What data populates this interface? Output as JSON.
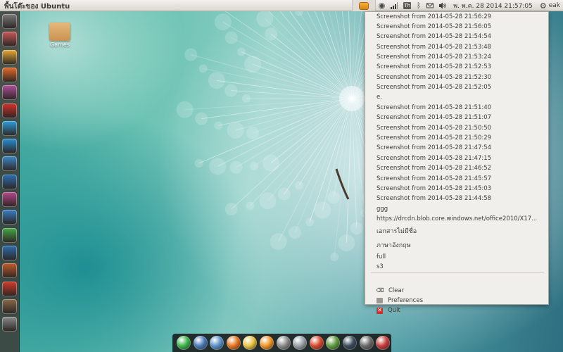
{
  "top_panel": {
    "window_title": "พื้นโต๊ะของ Ubuntu",
    "clock": "พ. พ.ค. 28 2014 21:57:05",
    "user": "eak",
    "keyboard_layout": "Th"
  },
  "desktop": {
    "icons": [
      {
        "label": "Games"
      }
    ]
  },
  "clipboard_menu": {
    "history": [
      "Screenshot from 2014-05-28 21:56:29",
      "Screenshot from 2014-05-28 21:56:05",
      "Screenshot from 2014-05-28 21:54:54",
      "Screenshot from 2014-05-28 21:53:48",
      "Screenshot from 2014-05-28 21:53:24",
      "Screenshot from 2014-05-28 21:52:53",
      "Screenshot from 2014-05-28 21:52:30",
      "Screenshot from 2014-05-28 21:52:05",
      "e.",
      "Screenshot from 2014-05-28 21:51:40",
      "Screenshot from 2014-05-28 21:51:07",
      "Screenshot from 2014-05-28 21:50:50",
      "Screenshot from 2014-05-28 21:50:29",
      "Screenshot from 2014-05-28 21:47:54",
      "Screenshot from 2014-05-28 21:47:15",
      "Screenshot from 2014-05-28 21:46:52",
      "Screenshot from 2014-05-28 21:45:57",
      "Screenshot from 2014-05-28 21:45:03",
      "Screenshot from 2014-05-28 21:44:58",
      "ggg",
      "https://drcdn.blob.core.windows.net/office2010/X17...",
      "เอกสารไม่มีชื่อ",
      "ภาษาอังกฤษ",
      " full",
      "s3"
    ],
    "actions": {
      "clear": "Clear",
      "preferences": "Preferences",
      "quit": "Quit"
    }
  },
  "launcher": {
    "items": [
      {
        "icon": "dash-home-icon",
        "color": "#7b7b7b"
      },
      {
        "icon": "files-icon",
        "color": "#c9595a"
      },
      {
        "icon": "chrome-icon",
        "color": "#e7a937"
      },
      {
        "icon": "firefox-icon",
        "color": "#e66b2a"
      },
      {
        "icon": "software-center-icon",
        "color": "#b0509a"
      },
      {
        "icon": "filezilla-icon",
        "color": "#d4322a"
      },
      {
        "icon": "skype-icon",
        "color": "#2d9fdb"
      },
      {
        "icon": "telegram-icon",
        "color": "#2a8fd6"
      },
      {
        "icon": "screenshot-icon",
        "color": "#3d88c8"
      },
      {
        "icon": "deluge-icon",
        "color": "#2f6fb2"
      },
      {
        "icon": "headphones-icon",
        "color": "#b7478d"
      },
      {
        "icon": "dropbox-icon",
        "color": "#3a7ec5"
      },
      {
        "icon": "bean-icon",
        "color": "#49a84a"
      },
      {
        "icon": "pidgin-icon",
        "color": "#2f6fae"
      },
      {
        "icon": "virtualbox-icon",
        "color": "#c55a2a"
      },
      {
        "icon": "media-player-icon",
        "color": "#d33a2a"
      },
      {
        "icon": "image-viewer-icon",
        "color": "#8a6a4a"
      },
      {
        "icon": "trash-icon",
        "color": "#8c8c8c"
      }
    ]
  },
  "dock": {
    "items": [
      {
        "icon": "line-icon",
        "color": "#3bb54a"
      },
      {
        "icon": "user-icon",
        "color": "#4a79b8"
      },
      {
        "icon": "mail-icon",
        "color": "#5a90c8"
      },
      {
        "icon": "vlc-icon",
        "color": "#e8741e"
      },
      {
        "icon": "stickies-icon",
        "color": "#e9c341"
      },
      {
        "icon": "orange-app-icon",
        "color": "#f39526"
      },
      {
        "icon": "disc-icon",
        "color": "#8a8a8a"
      },
      {
        "icon": "camera-icon",
        "color": "#9aa0a8"
      },
      {
        "icon": "chrome-dock-icon",
        "color": "#d9472b"
      },
      {
        "icon": "minecraft-icon",
        "color": "#5d9b3b"
      },
      {
        "icon": "steam-icon",
        "color": "#3a4a5a"
      },
      {
        "icon": "unknown-app-icon",
        "color": "#6a6a6a"
      },
      {
        "icon": "gallery-icon",
        "color": "#c83a3a"
      }
    ]
  }
}
